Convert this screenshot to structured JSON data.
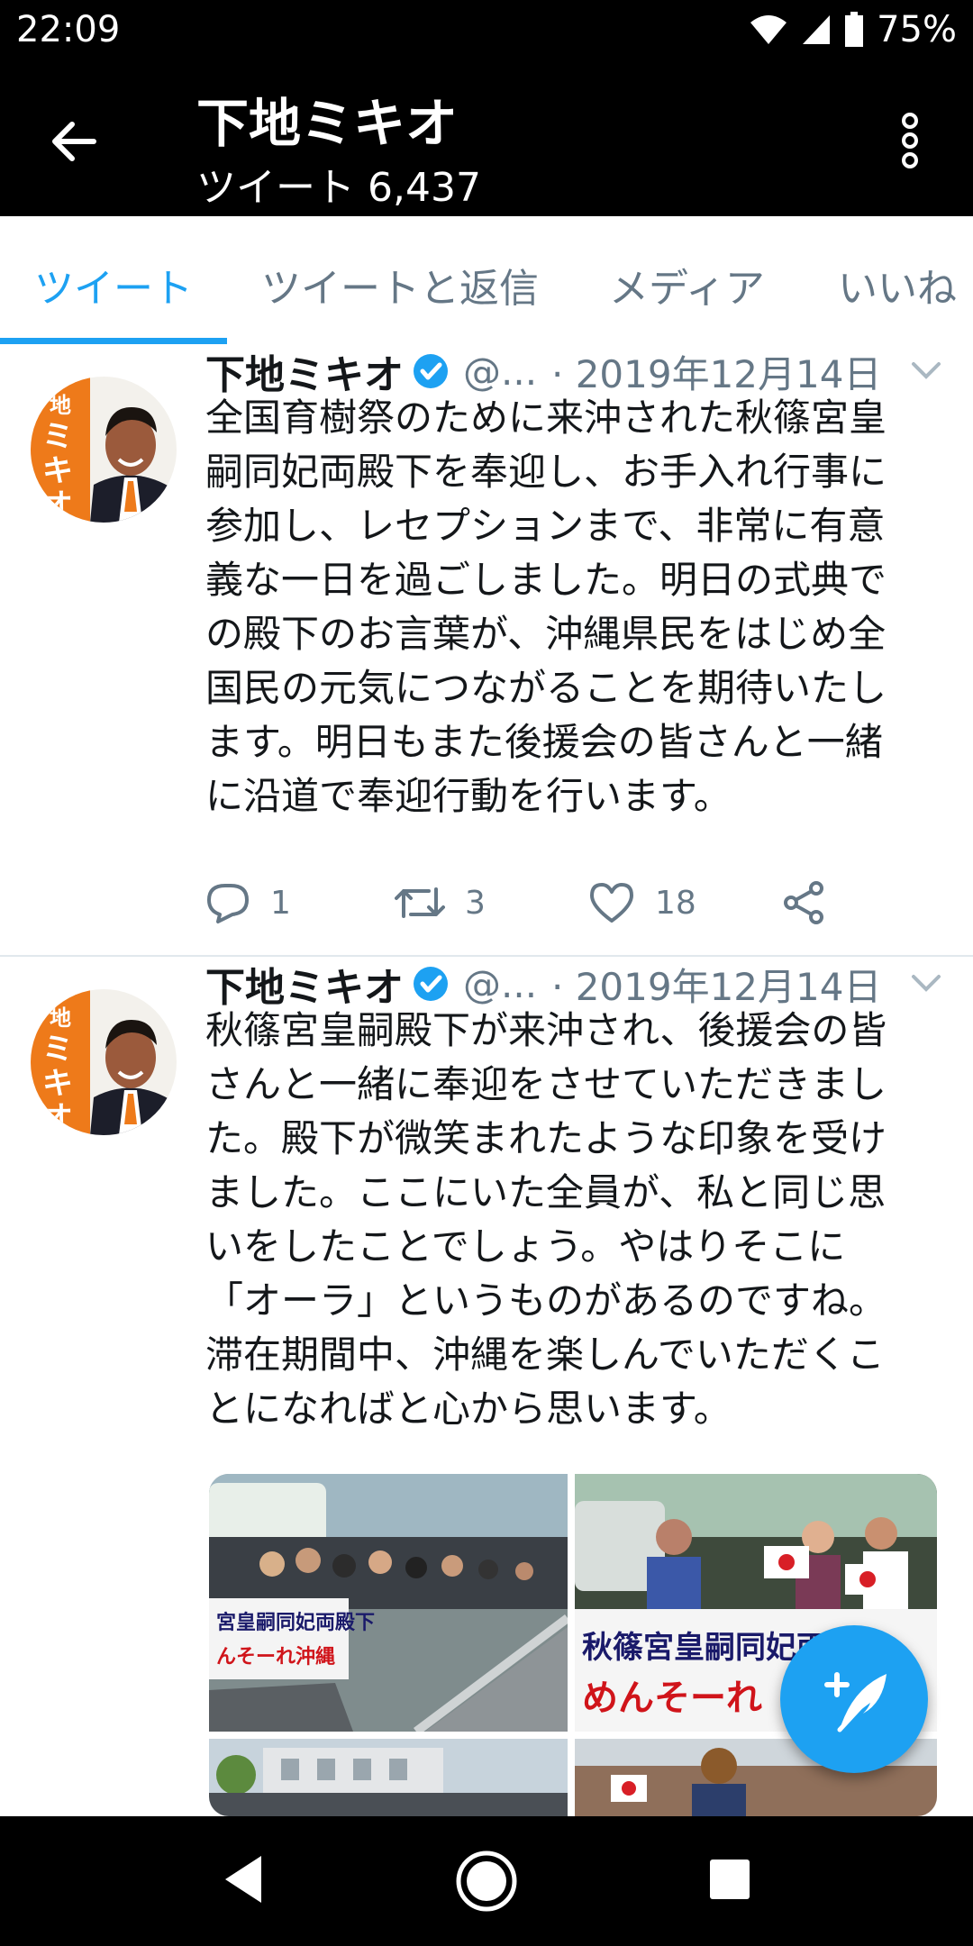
{
  "status_bar": {
    "time": "22:09",
    "battery": "75%",
    "icons": [
      "wifi-icon",
      "signal-icon",
      "battery-icon"
    ]
  },
  "header": {
    "title": "下地ミキオ",
    "subtitle": "ツイート 6,437"
  },
  "tabs": [
    {
      "label": "ツイート",
      "active": true
    },
    {
      "label": "ツイートと返信",
      "active": false
    },
    {
      "label": "メディア",
      "active": false
    },
    {
      "label": "いいね",
      "active": false
    }
  ],
  "tweets": [
    {
      "name": "下地ミキオ",
      "handle": "@...",
      "date": "· 2019年12月14日",
      "text": "全国育樹祭のために来沖された秋篠宮皇\n嗣同妃両殿下を奉迎し、お手入れ行事に\n参加し、レセプションまで、非常に有意\n義な一日を過ごしました。明日の式典で\nの殿下のお言葉が、沖縄県民をはじめ全\n国民の元気につながることを期待いたし\nます。明日もまた後援会の皆さんと一緒\nに沿道で奉迎行動を行います。",
      "replies": "1",
      "retweets": "3",
      "likes": "18"
    },
    {
      "name": "下地ミキオ",
      "handle": "@...",
      "date": "· 2019年12月14日",
      "text": "秋篠宮皇嗣殿下が来沖され、後援会の皆\nさんと一緒に奉迎をさせていただきまし\nた。殿下が微笑まれたような印象を受け\nました。ここにいた全員が、私と同じ思\nいをしたことでしょう。やはりそこに\n「オーラ」というものがあるのですね。\n滞在期間中、沖縄を楽しんでいただくこ\nとになればと心から思います。",
      "photo_banner_1": "宮皇嗣同妃両殿下",
      "photo_banner_1b": "んそーれ沖縄",
      "photo_banner_2": "秋篠宮皇嗣同妃両殿下",
      "photo_banner_2b": "めんそーれ"
    }
  ],
  "avatar_text": "下地ミキオ",
  "colors": {
    "accent": "#1da1f2",
    "secondary_text": "#657786",
    "divider": "#e1e8ed",
    "avatar_orange": "#ee7a1a"
  }
}
